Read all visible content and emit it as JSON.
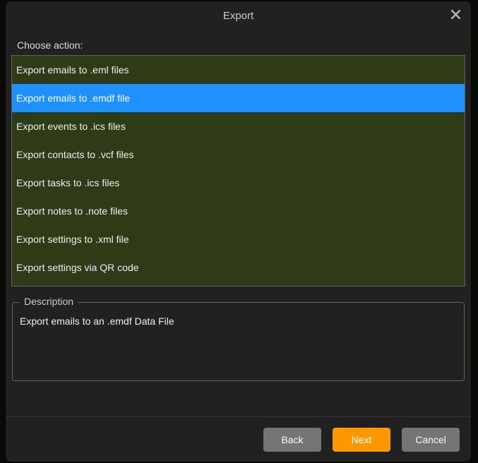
{
  "dialog": {
    "title": "Export",
    "choose_label": "Choose action:",
    "actions": [
      {
        "label": "Export emails to .eml files",
        "selected": false
      },
      {
        "label": "Export emails to .emdf file",
        "selected": true
      },
      {
        "label": "Export events to .ics files",
        "selected": false
      },
      {
        "label": "Export contacts to .vcf files",
        "selected": false
      },
      {
        "label": "Export tasks to .ics files",
        "selected": false
      },
      {
        "label": "Export notes to .note files",
        "selected": false
      },
      {
        "label": "Export settings to .xml file",
        "selected": false
      },
      {
        "label": "Export settings via QR code",
        "selected": false
      }
    ],
    "description_legend": "Description",
    "description_text": "Export emails to an .emdf Data File",
    "buttons": {
      "back": "Back",
      "next": "Next",
      "cancel": "Cancel"
    }
  },
  "colors": {
    "dialog_bg": "#212121",
    "list_bg": "#2f3b17",
    "selected_bg": "#1e90ff",
    "primary_bg": "#ff9800",
    "gray_btn_bg": "#757575",
    "border": "#616161"
  }
}
